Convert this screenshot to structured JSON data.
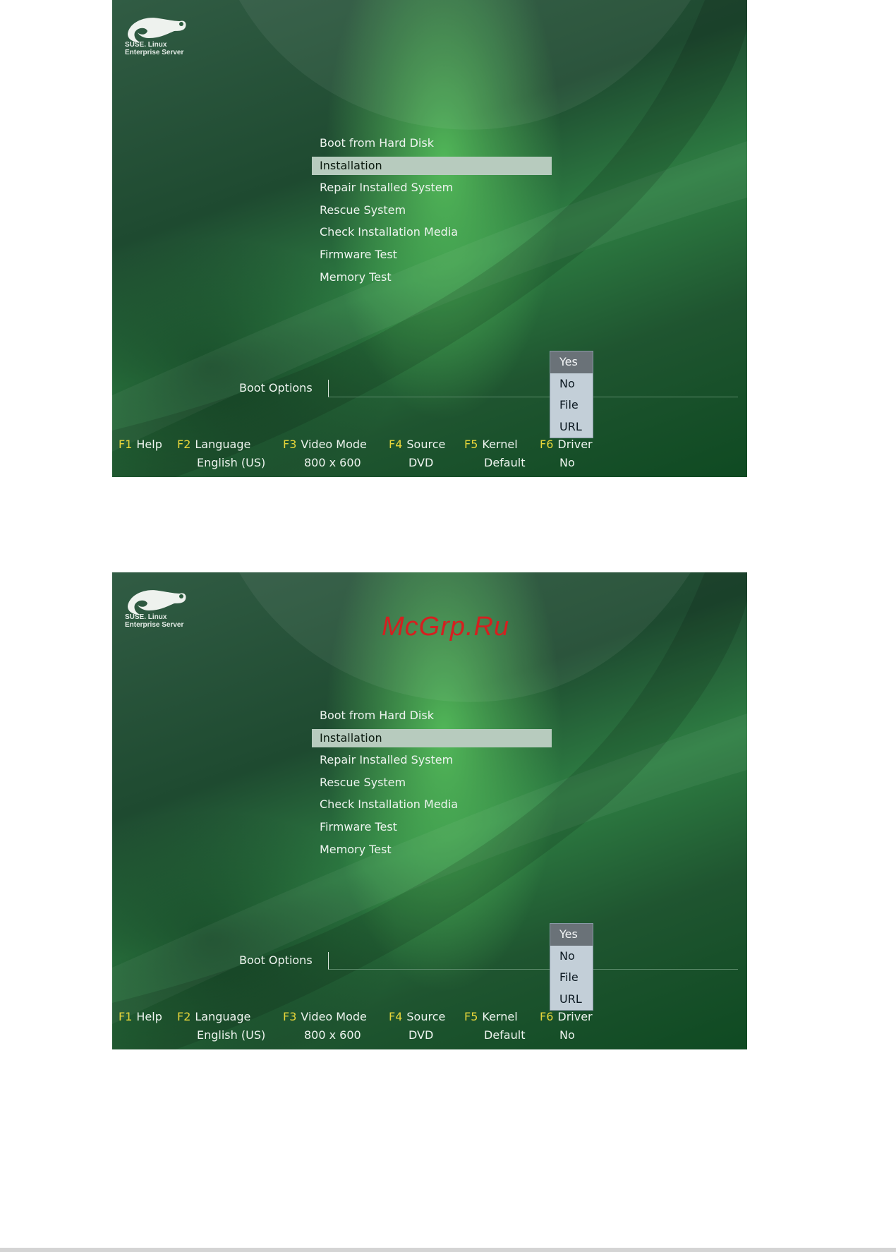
{
  "logo": {
    "line1": "SUSE. Linux",
    "line2": "Enterprise Server",
    "icon": "chameleon-icon"
  },
  "watermark": "McGrp.Ru",
  "menu": [
    "Boot from Hard Disk",
    "Installation",
    "Repair Installed System",
    "Rescue System",
    "Check Installation Media",
    "Firmware Test",
    "Memory Test"
  ],
  "selected_menu": "Installation",
  "boot_options_label": "Boot Options",
  "boot_options_value": "",
  "dropdown": [
    "Yes",
    "No",
    "File",
    "URL"
  ],
  "dropdown_selected": "Yes",
  "fkeys": [
    {
      "key": "F1",
      "label": "Help",
      "value": ""
    },
    {
      "key": "F2",
      "label": "Language",
      "value": "English (US)"
    },
    {
      "key": "F3",
      "label": "Video Mode",
      "value": "800 x 600"
    },
    {
      "key": "F4",
      "label": "Source",
      "value": "DVD"
    },
    {
      "key": "F5",
      "label": "Kernel",
      "value": "Default"
    },
    {
      "key": "F6",
      "label": "Driver",
      "value": "No"
    }
  ],
  "colors": {
    "fkey": "#e8d63a",
    "selection": "#b7cbbe",
    "dropdown_selected": "#6a7278"
  }
}
